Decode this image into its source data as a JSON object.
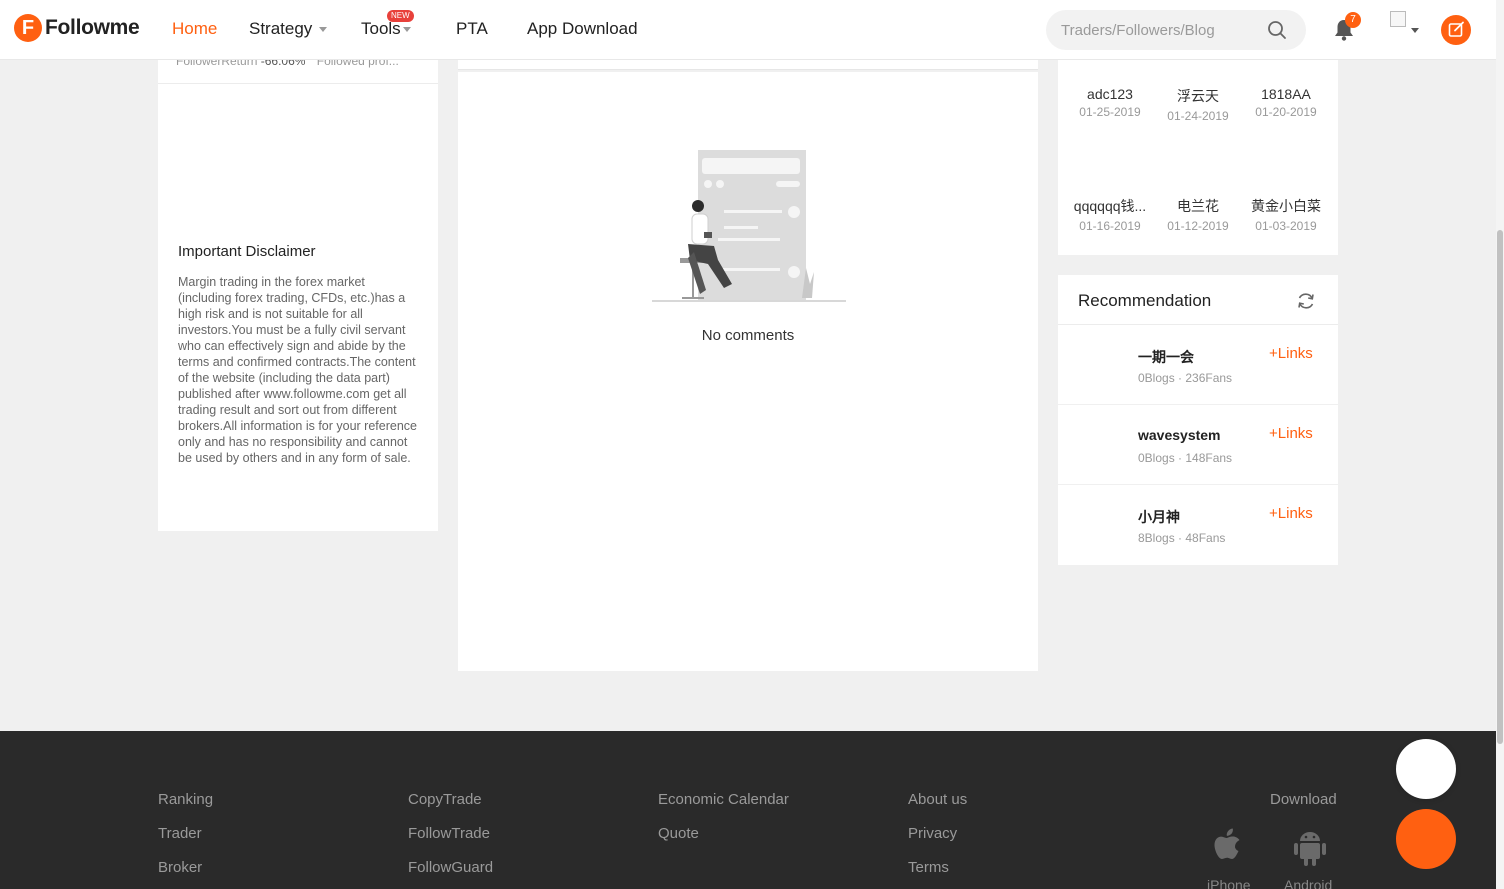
{
  "header": {
    "logo_letter": "F",
    "logo_text": "Followme",
    "nav": [
      "Home",
      "Strategy",
      "Tools",
      "PTA",
      "App Download"
    ],
    "new_badge": "NEW",
    "search_placeholder": "Traders/Followers/Blog",
    "notification_count": "7",
    "accent_color": "#ff6011"
  },
  "left_panel": {
    "follower_return_label": "FollowerReturn",
    "follower_return_value": "-66.06%",
    "followed_profit_label": "Followed prof...",
    "disclaimer_title": "Important Disclaimer",
    "disclaimer_text": "Margin trading in the forex market (including forex trading, CFDs, etc.)has a high risk and is not suitable for all investors.You must be a fully civil servant who can effectively sign and abide by the terms and confirmed contracts.The content of the website (including the data part) published after www.followme.com get all trading result and sort out from different brokers.All information is for your reference only and has no responsibility and cannot be used by others and in any form of sale."
  },
  "comments": {
    "empty_text": "No comments"
  },
  "fans": [
    {
      "name": "adc123",
      "date": "01-25-2019"
    },
    {
      "name": "浮云天",
      "date": "01-24-2019"
    },
    {
      "name": "1818AA",
      "date": "01-20-2019"
    },
    {
      "name": "qqqqqq钱...",
      "date": "01-16-2019"
    },
    {
      "name": "电兰花",
      "date": "01-12-2019"
    },
    {
      "name": "黄金小白菜",
      "date": "01-03-2019"
    }
  ],
  "recommendation": {
    "title": "Recommendation",
    "link_label": "Links",
    "items": [
      {
        "name": "一期一会",
        "stats": "0Blogs · 236Fans"
      },
      {
        "name": "wavesystem",
        "stats": "0Blogs · 148Fans"
      },
      {
        "name": "小月神",
        "stats": "8Blogs · 48Fans"
      }
    ]
  },
  "footer": {
    "col1": [
      "Ranking",
      "Trader",
      "Broker"
    ],
    "col2": [
      "CopyTrade",
      "FollowTrade",
      "FollowGuard"
    ],
    "col3": [
      "Economic Calendar",
      "Quote"
    ],
    "col4": [
      "About us",
      "Privacy",
      "Terms"
    ],
    "download_title": "Download",
    "download_iphone": "iPhone",
    "download_android": "Android"
  }
}
